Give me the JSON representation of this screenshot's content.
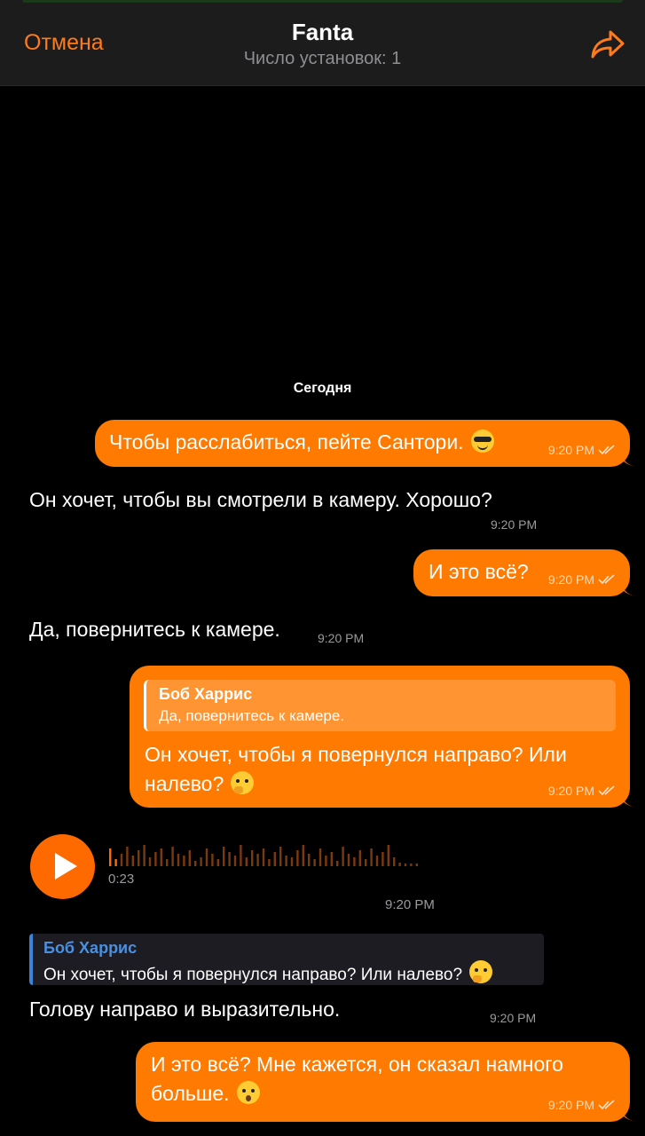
{
  "header": {
    "cancel_label": "Отмена",
    "title": "Fanta",
    "subtitle": "Число установок: 1"
  },
  "date_separator": "Сегодня",
  "messages": [
    {
      "text": "Чтобы расслабиться, пейте Сантори.",
      "time": "9:20 PM",
      "emoji": "smiling-face-with-sunglasses"
    },
    {
      "text": "Он хочет, чтобы вы смотрели в камеру. Хорошо?",
      "time": "9:20 PM"
    },
    {
      "text": "И это всё?",
      "time": "9:20 PM"
    },
    {
      "text": "Да, повернитесь к камере.",
      "time": "9:20 PM"
    },
    {
      "reply_name": "Боб Харрис",
      "reply_text": "Да, повернитесь к камере.",
      "text_line1": "Он хочет, чтобы я повернулся направо? Или",
      "text_line2": "налево?",
      "time": "9:20 PM",
      "emoji": "thinking-face"
    },
    {
      "duration": "0:23",
      "time": "9:20 PM"
    },
    {
      "reply_name": "Боб Харрис",
      "reply_text": "Он хочет, чтобы я повернулся направо? Или налево?",
      "text": "Голову направо и выразительно.",
      "time": "9:20 PM",
      "emoji": "thinking-face"
    },
    {
      "text_line1": "И это всё? Мне кажется, он сказал намного",
      "text_line2": "больше.",
      "time": "9:20 PM",
      "emoji": "hushed-face"
    }
  ],
  "colors": {
    "accent": "#ff7a00",
    "reply_blue": "#4a90e2"
  }
}
